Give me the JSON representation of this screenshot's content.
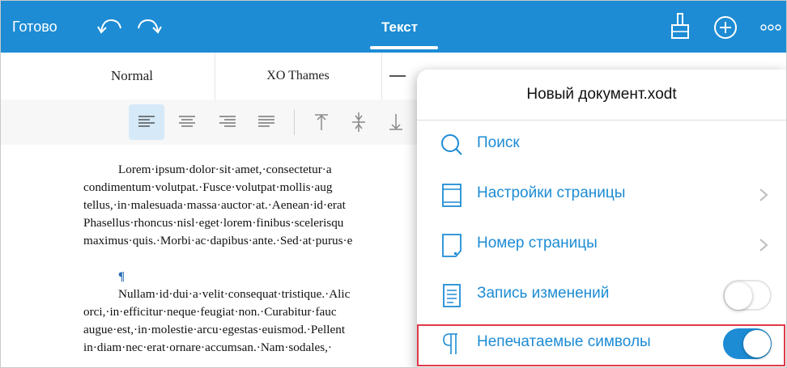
{
  "toolbar": {
    "done_label": "Готово",
    "active_tab": "Текст",
    "icons": [
      "undo-icon",
      "redo-icon",
      "brush-icon",
      "plus-icon",
      "more-icon"
    ],
    "bg_color": "#1d8cd4"
  },
  "format": {
    "paragraph_style": "Normal",
    "font_name": "XO Thames",
    "alignment_active": "left"
  },
  "document": {
    "paragraph1": [
      "Lorem·ipsum·dolor·sit·amet,·consectetur·a",
      "condimentum·volutpat.·Fusce·volutpat·mollis·aug",
      "tellus,·in·malesuada·massa·auctor·at.·Aenean·id·erat",
      "Phasellus·rhoncus·nisl·eget·lorem·finibus·scelerisqu",
      "maximus·quis.·Morbi·ac·dapibus·ante.·Sed·at·purus·e"
    ],
    "pilcrow": "¶",
    "paragraph2": [
      "Nullam·id·dui·a·velit·consequat·tristique.·Alic",
      "orci,·in·efficitur·neque·feugiat·non.·Curabitur·fauc",
      "augue·est,·in·molestie·arcu·egestas·euismod.·Pellent",
      "in·diam·nec·erat·ornare·accumsan.·Nam·sodales,·"
    ]
  },
  "menu": {
    "title": "Новый документ.xodt",
    "items": [
      {
        "label": "Поиск",
        "icon": "search-icon"
      },
      {
        "label": "Настройки страницы",
        "icon": "page-settings-icon",
        "has_chevron": true
      },
      {
        "label": "Номер страницы",
        "icon": "page-number-icon",
        "has_chevron": true
      },
      {
        "label": "Запись изменений",
        "icon": "track-changes-icon",
        "toggle": false
      },
      {
        "label": "Непечатаемые символы",
        "icon": "pilcrow-icon",
        "toggle": true,
        "highlighted": true
      }
    ],
    "accent_color": "#1d8cd4",
    "highlight_color": "#e03a49"
  }
}
